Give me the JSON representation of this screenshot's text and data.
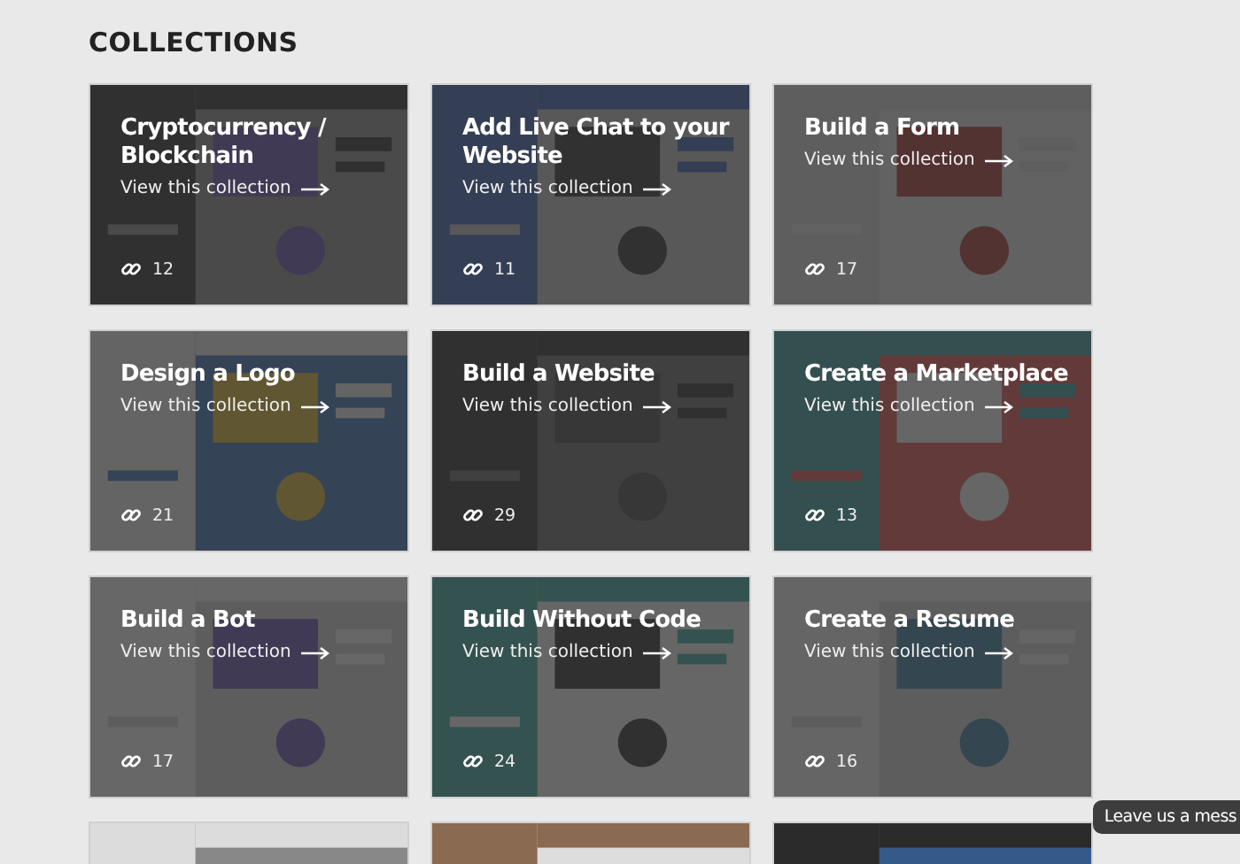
{
  "heading": "COLLECTIONS",
  "collections": [
    {
      "title": "Cryptocurrency / Blockchain",
      "link": "View this collection",
      "count": "12"
    },
    {
      "title": "Add Live Chat to your Website",
      "link": "View this collection",
      "count": "11"
    },
    {
      "title": "Build a Form",
      "link": "View this collection",
      "count": "17"
    },
    {
      "title": "Design a Logo",
      "link": "View this collection",
      "count": "21"
    },
    {
      "title": "Build a Website",
      "link": "View this collection",
      "count": "29"
    },
    {
      "title": "Create a Marketplace",
      "link": "View this collection",
      "count": "13"
    },
    {
      "title": "Build a Bot",
      "link": "View this collection",
      "count": "17"
    },
    {
      "title": "Build Without Code",
      "link": "View this collection",
      "count": "24"
    },
    {
      "title": "Create a Resume",
      "link": "View this collection",
      "count": "16"
    }
  ],
  "chat_tooltip": {
    "label": "Leave us a mess"
  }
}
